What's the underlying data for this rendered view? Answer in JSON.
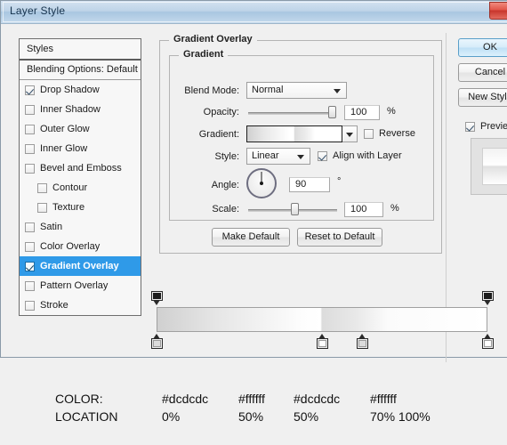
{
  "window": {
    "title": "Layer Style",
    "close_icon": "close-icon"
  },
  "sidebar": {
    "header": "Styles",
    "blending_options": "Blending Options: Default",
    "items": [
      {
        "label": "Drop Shadow",
        "checked": true,
        "indent": false,
        "selected": false
      },
      {
        "label": "Inner Shadow",
        "checked": false,
        "indent": false,
        "selected": false
      },
      {
        "label": "Outer Glow",
        "checked": false,
        "indent": false,
        "selected": false
      },
      {
        "label": "Inner Glow",
        "checked": false,
        "indent": false,
        "selected": false
      },
      {
        "label": "Bevel and Emboss",
        "checked": false,
        "indent": false,
        "selected": false
      },
      {
        "label": "Contour",
        "checked": false,
        "indent": true,
        "selected": false
      },
      {
        "label": "Texture",
        "checked": false,
        "indent": true,
        "selected": false
      },
      {
        "label": "Satin",
        "checked": false,
        "indent": false,
        "selected": false
      },
      {
        "label": "Color Overlay",
        "checked": false,
        "indent": false,
        "selected": false
      },
      {
        "label": "Gradient Overlay",
        "checked": true,
        "indent": false,
        "selected": true
      },
      {
        "label": "Pattern Overlay",
        "checked": false,
        "indent": false,
        "selected": false
      },
      {
        "label": "Stroke",
        "checked": false,
        "indent": false,
        "selected": false
      }
    ],
    "selected_accent": "#2f9ae8"
  },
  "panel": {
    "group_title": "Gradient Overlay",
    "sub_group_title": "Gradient",
    "blend_mode": {
      "label": "Blend Mode:",
      "value": "Normal"
    },
    "opacity": {
      "label": "Opacity:",
      "value": "100",
      "unit": "%",
      "percent": 100
    },
    "gradient": {
      "label": "Gradient:",
      "reverse_label": "Reverse",
      "reverse_checked": false
    },
    "style": {
      "label": "Style:",
      "value": "Linear",
      "align_label": "Align with Layer",
      "align_checked": true
    },
    "angle": {
      "label": "Angle:",
      "value": "90",
      "unit": "°"
    },
    "scale": {
      "label": "Scale:",
      "value": "100",
      "unit": "%",
      "percent": 100
    },
    "make_default": "Make Default",
    "reset_to_default": "Reset to Default"
  },
  "buttons": {
    "ok": "OK",
    "cancel": "Cancel",
    "new_style": "New Style",
    "preview_label": "Preview",
    "preview_checked": true
  },
  "gradient_editor": {
    "opacity_stops": [
      {
        "location": 0
      },
      {
        "location": 100
      }
    ],
    "color_stops": [
      {
        "location": 0,
        "color": "#dcdcdc"
      },
      {
        "location": 50,
        "color": "#ffffff"
      },
      {
        "location": 62,
        "color": "#dcdcdc"
      },
      {
        "location": 100,
        "color": "#ffffff"
      }
    ]
  },
  "annotation": {
    "color_label": "COLOR:",
    "location_label": "LOCATION",
    "colors": [
      "#dcdcdc",
      "#ffffff",
      "#dcdcdc",
      "#ffffff"
    ],
    "locations": [
      "0%",
      "50%",
      "50%",
      "70% 100%"
    ]
  }
}
